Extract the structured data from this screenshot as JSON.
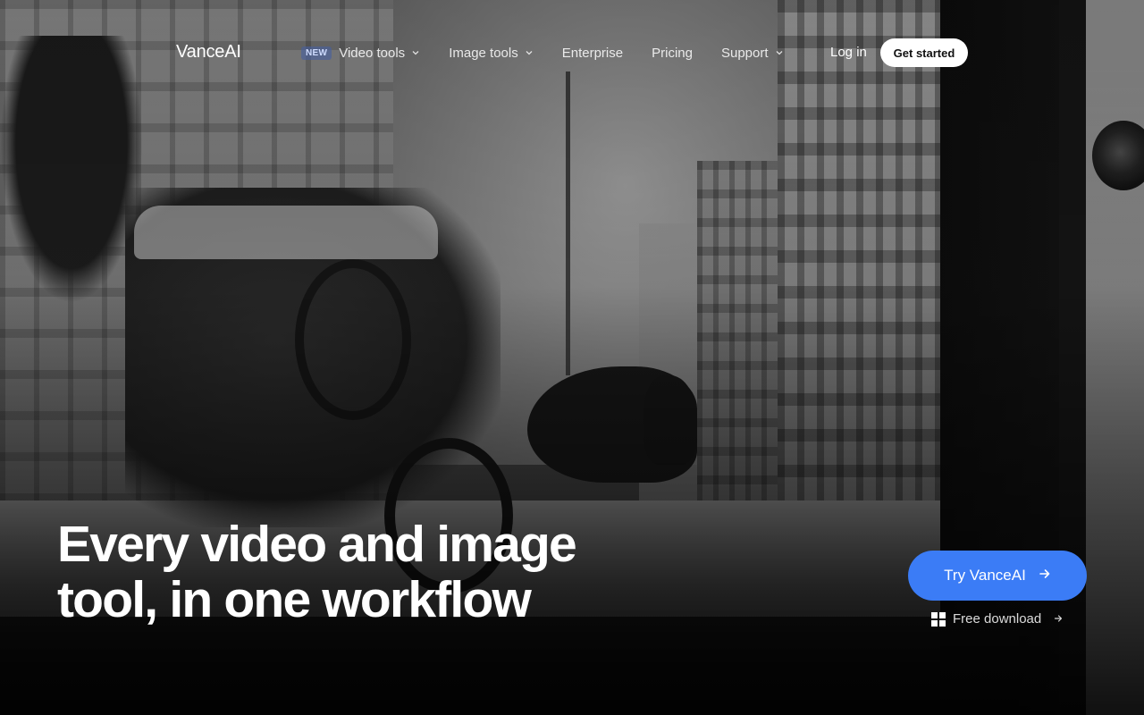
{
  "brand": {
    "name": "VanceAI"
  },
  "nav": {
    "items": [
      {
        "label": "Video tools",
        "badge": "NEW",
        "has_dropdown": true
      },
      {
        "label": "Image tools",
        "has_dropdown": true
      },
      {
        "label": "Enterprise",
        "has_dropdown": false
      },
      {
        "label": "Pricing",
        "has_dropdown": false
      },
      {
        "label": "Support",
        "has_dropdown": true
      }
    ],
    "login_label": "Log in",
    "get_started_label": "Get started"
  },
  "hero": {
    "headline_line1": "Every video and image",
    "headline_line2": "tool, in one workflow",
    "cta_label": "Try VanceAI",
    "download_label": "Free download"
  },
  "colors": {
    "accent": "#3b7cf6",
    "badge_bg": "#465fa0",
    "text": "#ffffff"
  },
  "icons": {
    "dropdown": "chevron-down-icon",
    "cta_arrow": "arrow-right-icon",
    "download_os": "windows-icon"
  }
}
